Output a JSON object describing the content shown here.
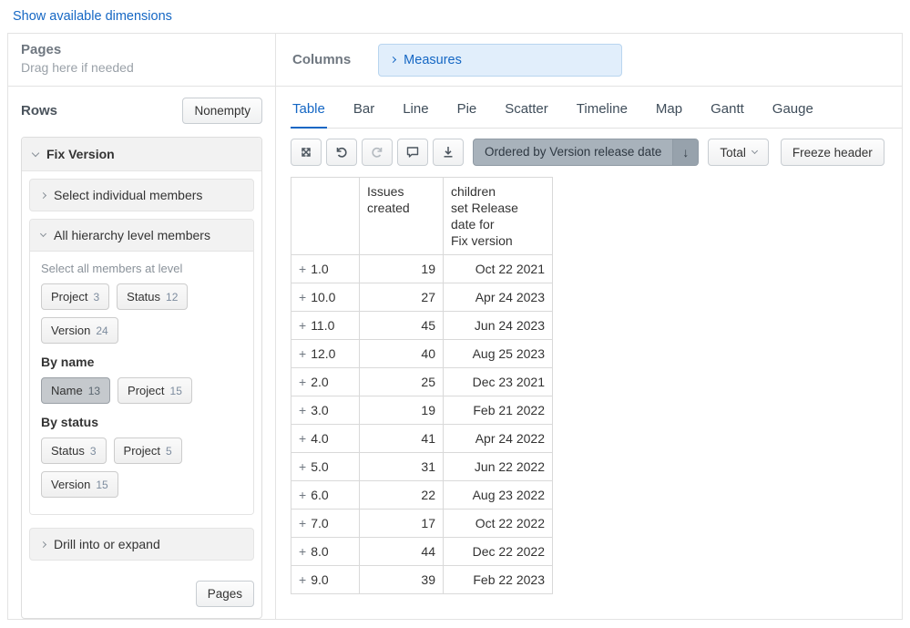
{
  "page": {
    "show_dimensions_link": "Show available dimensions"
  },
  "pages_zone": {
    "title": "Pages",
    "hint": "Drag here if needed"
  },
  "columns_zone": {
    "title": "Columns",
    "measures_label": "Measures"
  },
  "rows_zone": {
    "title": "Rows",
    "nonempty_button": "Nonempty",
    "pages_button": "Pages",
    "dimension": {
      "name": "Fix Version",
      "select_individual_label": "Select individual members",
      "drill_label": "Drill into or expand",
      "all_levels": {
        "title": "All hierarchy level members",
        "hint": "Select all members at level",
        "level_chips": [
          {
            "label": "Project",
            "count": "3"
          },
          {
            "label": "Status",
            "count": "12"
          },
          {
            "label": "Version",
            "count": "24"
          }
        ],
        "by_name_title": "By name",
        "by_name_chips": [
          {
            "label": "Name",
            "count": "13",
            "active": true
          },
          {
            "label": "Project",
            "count": "15"
          }
        ],
        "by_status_title": "By status",
        "by_status_chips": [
          {
            "label": "Status",
            "count": "3"
          },
          {
            "label": "Project",
            "count": "5"
          },
          {
            "label": "Version",
            "count": "15"
          }
        ]
      }
    }
  },
  "chart": {
    "tabs": [
      "Table",
      "Bar",
      "Line",
      "Pie",
      "Scatter",
      "Timeline",
      "Map",
      "Gantt",
      "Gauge"
    ],
    "active_tab": "Table",
    "toolbar": {
      "icons": [
        "swap-axes",
        "undo",
        "redo",
        "comment",
        "export"
      ],
      "order_button_label": "Ordered by Version release date",
      "order_button_arrow": "↓",
      "total_button_label": "Total",
      "freeze_button_label": "Freeze header"
    }
  },
  "table": {
    "columns": [
      "",
      "Issues\ncreated",
      "children\nset Release\ndate for\nFix version"
    ],
    "rows": [
      {
        "name": "1.0",
        "issues_created": "19",
        "release_date": "Oct 22 2021"
      },
      {
        "name": "10.0",
        "issues_created": "27",
        "release_date": "Apr 24 2023"
      },
      {
        "name": "11.0",
        "issues_created": "45",
        "release_date": "Jun 24 2023"
      },
      {
        "name": "12.0",
        "issues_created": "40",
        "release_date": "Aug 25 2023"
      },
      {
        "name": "2.0",
        "issues_created": "25",
        "release_date": "Dec 23 2021"
      },
      {
        "name": "3.0",
        "issues_created": "19",
        "release_date": "Feb 21 2022"
      },
      {
        "name": "4.0",
        "issues_created": "41",
        "release_date": "Apr 24 2022"
      },
      {
        "name": "5.0",
        "issues_created": "31",
        "release_date": "Jun 22 2022"
      },
      {
        "name": "6.0",
        "issues_created": "22",
        "release_date": "Aug 23 2022"
      },
      {
        "name": "7.0",
        "issues_created": "17",
        "release_date": "Oct 22 2022"
      },
      {
        "name": "8.0",
        "issues_created": "44",
        "release_date": "Dec 22 2022"
      },
      {
        "name": "9.0",
        "issues_created": "39",
        "release_date": "Feb 22 2023"
      }
    ]
  }
}
